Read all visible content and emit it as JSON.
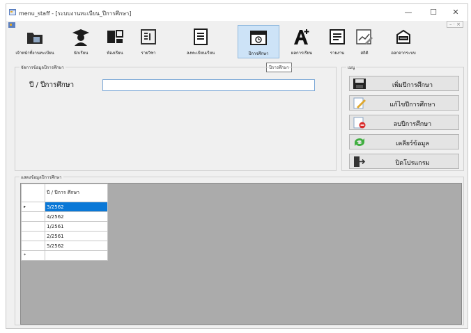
{
  "window": {
    "title": "menu_staff - [ระบบงานทะเบียน_ปีการศึกษา]",
    "minimize": "—",
    "maximize": "☐",
    "close": "✕",
    "mdi_controls": "– · ×"
  },
  "toolbar": {
    "items": [
      {
        "label": "เจ้าหน้าที่งานทะเบียน",
        "icon": "folder-icon"
      },
      {
        "label": "นักเรียน",
        "icon": "graduate-icon"
      },
      {
        "label": "ห้องเรียน",
        "icon": "classroom-icon"
      },
      {
        "label": "รายวิชา",
        "icon": "book-icon"
      },
      {
        "label": "ลงทะเบียนเรียน",
        "icon": "document-icon"
      },
      {
        "label": "ปีการศึกษา",
        "icon": "calendar-icon"
      },
      {
        "label": "ผลการเรียน",
        "icon": "grade-icon"
      },
      {
        "label": "รายงาน",
        "icon": "report-icon"
      },
      {
        "label": "สถิติ",
        "icon": "statistics-icon"
      },
      {
        "label": "ออกจากระบบ",
        "icon": "logout-icon"
      }
    ],
    "active_index": 5,
    "tooltip": "ปีการศึกษา"
  },
  "manage_group": {
    "title": "จัดการข้อมูลปีการศึกษา",
    "year_label": "ปี / ปีการศึกษา",
    "year_value": ""
  },
  "menu_group": {
    "title": "เมนู",
    "buttons": [
      {
        "label": "เพิ่มปีการศึกษา",
        "icon": "save-icon"
      },
      {
        "label": "แก้ไขปีการศึกษา",
        "icon": "edit-icon"
      },
      {
        "label": "ลบปีการศึกษา",
        "icon": "delete-icon"
      },
      {
        "label": "เคลียร์ข้อมูล",
        "icon": "refresh-icon"
      },
      {
        "label": "ปิดโปรแกรม",
        "icon": "exit-icon"
      }
    ]
  },
  "data_group": {
    "title": "แสดงข้อมูลปีการศึกษา",
    "column_header": "ปี / ปีการ ศึกษา",
    "current_row_marker": "▸",
    "new_row_marker": "*",
    "rows": [
      "3/2562",
      "4/2562",
      "1/2561",
      "2/2561",
      "5/2562"
    ],
    "selected_index": 0
  },
  "colors": {
    "selection": "#0a78d7",
    "grid_background": "#ababab",
    "active_tool": "#cde3f7"
  }
}
